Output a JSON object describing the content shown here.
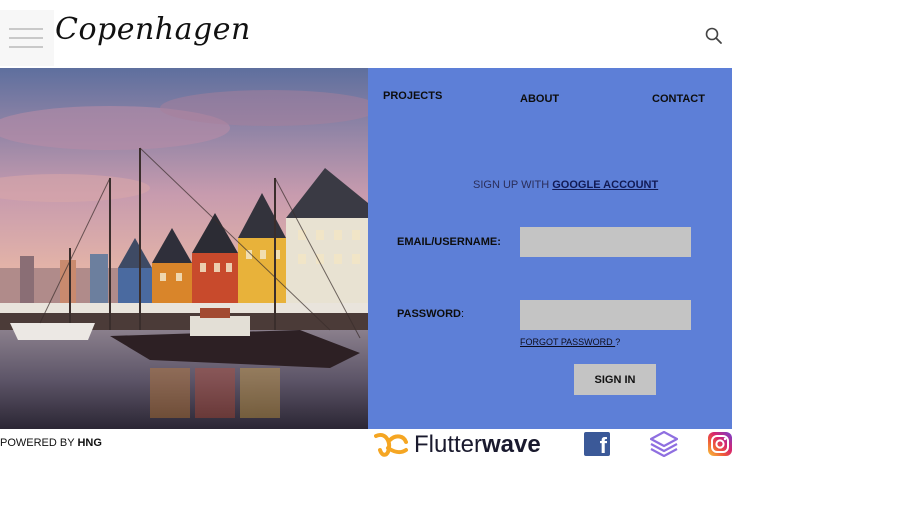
{
  "header": {
    "logo_text": "Copenhagen",
    "menu_icon": "hamburger-menu-icon",
    "search_icon": "search-icon"
  },
  "nav": {
    "projects": "PROJECTS",
    "about": "ABOUT",
    "contact": "CONTACT"
  },
  "signup": {
    "prefix": "SIGN UP WITH ",
    "link": "GOOGLE ACCOUNT"
  },
  "form": {
    "email_label": "EMAIL/USERNAME:",
    "email_value": "",
    "password_label": "PASSWORD",
    "password_colon": ":",
    "password_value": "",
    "forgot_link": "FORGOT PASSWORD ",
    "forgot_suffix": "?",
    "signin_label": "SIGN IN"
  },
  "footer": {
    "powered_prefix": "POWERED BY ",
    "powered_brand": "HNG",
    "flutterwave_part1": "Flutter",
    "flutterwave_part2": "wave",
    "icons": [
      "flutterwave-logo-icon",
      "facebook-icon",
      "stack-layers-icon",
      "instagram-icon"
    ]
  },
  "colors": {
    "panel": "#5d7fd7",
    "field": "#c4c4c4",
    "flutterwave_orange": "#f5a623"
  }
}
